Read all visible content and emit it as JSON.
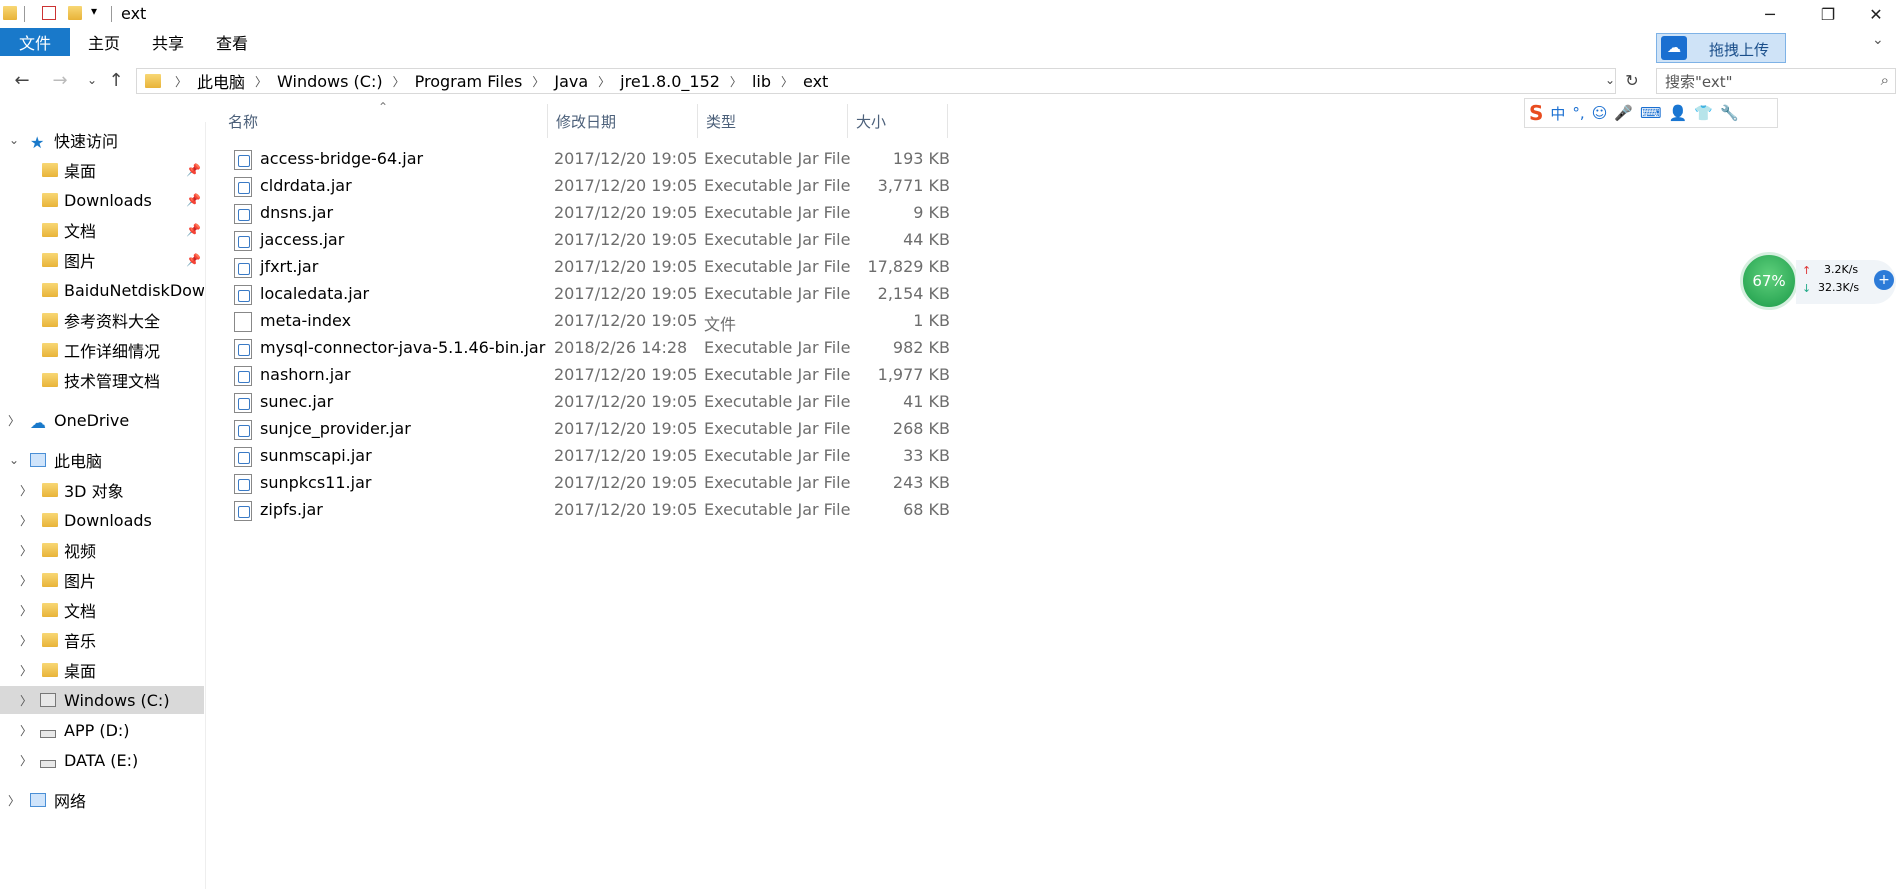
{
  "window": {
    "title": "ext",
    "minimize": "─",
    "maximize": "❐",
    "close": "✕"
  },
  "ribbon": {
    "tabs": [
      "文件",
      "主页",
      "共享",
      "查看"
    ],
    "expand_icon": "chevron-down-icon",
    "help_icon": "help-icon"
  },
  "address": {
    "crumbs": [
      "此电脑",
      "Windows (C:)",
      "Program Files",
      "Java",
      "jre1.8.0_152",
      "lib",
      "ext"
    ],
    "search_placeholder": "搜索\"ext\""
  },
  "sidebar": {
    "quick_access": "快速访问",
    "quick_items": [
      "桌面",
      "Downloads",
      "文档",
      "图片",
      "BaiduNetdiskDown",
      "参考资料大全",
      "工作详细情况",
      "技术管理文档"
    ],
    "onedrive": "OneDrive",
    "this_pc": "此电脑",
    "pc_items": [
      "3D 对象",
      "Downloads",
      "视频",
      "图片",
      "文档",
      "音乐",
      "桌面",
      "Windows (C:)",
      "APP (D:)",
      "DATA (E:)"
    ],
    "network": "网络",
    "selected": "Windows (C:)"
  },
  "columns": {
    "name": "名称",
    "date": "修改日期",
    "type": "类型",
    "size": "大小"
  },
  "files": [
    {
      "name": "access-bridge-64.jar",
      "date": "2017/12/20 19:05",
      "type": "Executable Jar File",
      "size": "193 KB"
    },
    {
      "name": "cldrdata.jar",
      "date": "2017/12/20 19:05",
      "type": "Executable Jar File",
      "size": "3,771 KB"
    },
    {
      "name": "dnsns.jar",
      "date": "2017/12/20 19:05",
      "type": "Executable Jar File",
      "size": "9 KB"
    },
    {
      "name": "jaccess.jar",
      "date": "2017/12/20 19:05",
      "type": "Executable Jar File",
      "size": "44 KB"
    },
    {
      "name": "jfxrt.jar",
      "date": "2017/12/20 19:05",
      "type": "Executable Jar File",
      "size": "17,829 KB"
    },
    {
      "name": "localedata.jar",
      "date": "2017/12/20 19:05",
      "type": "Executable Jar File",
      "size": "2,154 KB"
    },
    {
      "name": "meta-index",
      "date": "2017/12/20 19:05",
      "type": "文件",
      "size": "1 KB"
    },
    {
      "name": "mysql-connector-java-5.1.46-bin.jar",
      "date": "2018/2/26 14:28",
      "type": "Executable Jar File",
      "size": "982 KB"
    },
    {
      "name": "nashorn.jar",
      "date": "2017/12/20 19:05",
      "type": "Executable Jar File",
      "size": "1,977 KB"
    },
    {
      "name": "sunec.jar",
      "date": "2017/12/20 19:05",
      "type": "Executable Jar File",
      "size": "41 KB"
    },
    {
      "name": "sunjce_provider.jar",
      "date": "2017/12/20 19:05",
      "type": "Executable Jar File",
      "size": "268 KB"
    },
    {
      "name": "sunmscapi.jar",
      "date": "2017/12/20 19:05",
      "type": "Executable Jar File",
      "size": "33 KB"
    },
    {
      "name": "sunpkcs11.jar",
      "date": "2017/12/20 19:05",
      "type": "Executable Jar File",
      "size": "243 KB"
    },
    {
      "name": "zipfs.jar",
      "date": "2017/12/20 19:05",
      "type": "Executable Jar File",
      "size": "68 KB"
    }
  ],
  "widgets": {
    "upload_label": "拖拽上传",
    "ime_mode": "中",
    "net_percent": "67%",
    "upload_speed": "3.2K/s",
    "download_speed": "32.3K/s"
  },
  "colors": {
    "accent": "#1979ca",
    "header_text": "#4c607a",
    "secondary_text": "#6d6d6d",
    "selected_bg": "#d9d9d9"
  }
}
